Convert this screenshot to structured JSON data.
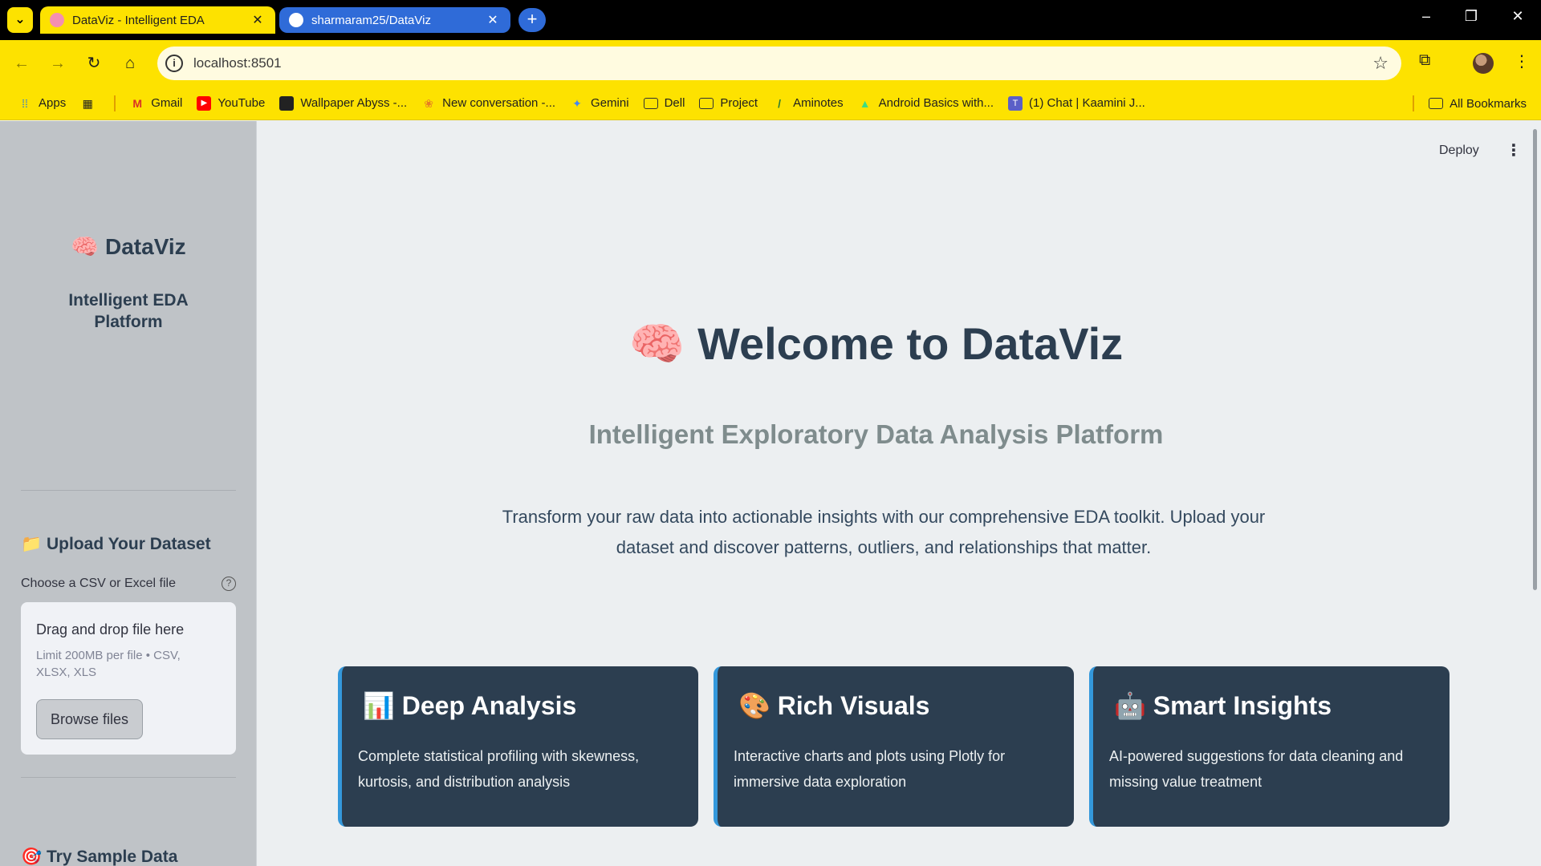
{
  "browser": {
    "tabs": [
      {
        "title": "DataViz - Intelligent EDA",
        "active": true
      },
      {
        "title": "sharmaram25/DataViz",
        "active": false
      }
    ],
    "url": "localhost:8501",
    "bookmarks": [
      {
        "label": "Apps",
        "icon": "apps-grid-icon"
      },
      {
        "label": "Gmail",
        "icon": "gmail-icon"
      },
      {
        "label": "YouTube",
        "icon": "youtube-icon"
      },
      {
        "label": "Wallpaper Abyss -...",
        "icon": "wallpaper-icon"
      },
      {
        "label": "New conversation -...",
        "icon": "copilot-icon"
      },
      {
        "label": "Gemini",
        "icon": "gemini-icon"
      },
      {
        "label": "Dell",
        "icon": "folder-icon"
      },
      {
        "label": "Project",
        "icon": "folder-icon"
      },
      {
        "label": "Aminotes",
        "icon": "aminotes-icon"
      },
      {
        "label": "Android Basics with...",
        "icon": "android-icon"
      },
      {
        "label": "(1) Chat | Kaamini J...",
        "icon": "teams-icon"
      }
    ],
    "all_bookmarks": "All Bookmarks",
    "accent": "#fde200"
  },
  "sidebar": {
    "logo": "🧠 DataViz",
    "tagline": "Intelligent EDA Platform",
    "upload_heading": "📁 Upload Your Dataset",
    "upload_label": "Choose a CSV or Excel file",
    "dropzone_title": "Drag and drop file here",
    "dropzone_limit": "Limit 200MB per file • CSV, XLSX, XLS",
    "browse_label": "Browse files",
    "sample_heading": "🎯 Try Sample Data"
  },
  "header": {
    "deploy_label": "Deploy"
  },
  "main": {
    "title": "🧠 Welcome to DataViz",
    "subtitle": "Intelligent Exploratory Data Analysis Platform",
    "description": "Transform your raw data into actionable insights with our comprehensive EDA toolkit. Upload your dataset and discover patterns, outliers, and relationships that matter.",
    "cards": [
      {
        "title": "📊 Deep Analysis",
        "description": "Complete statistical profiling with skewness, kurtosis, and distribution analysis"
      },
      {
        "title": "🎨 Rich Visuals",
        "description": "Interactive charts and plots using Plotly for immersive data exploration"
      },
      {
        "title": "🤖 Smart Insights",
        "description": "AI-powered suggestions for data cleaning and missing value treatment"
      }
    ],
    "card_color": "#2c3e50",
    "card_accent": "#3498db"
  }
}
